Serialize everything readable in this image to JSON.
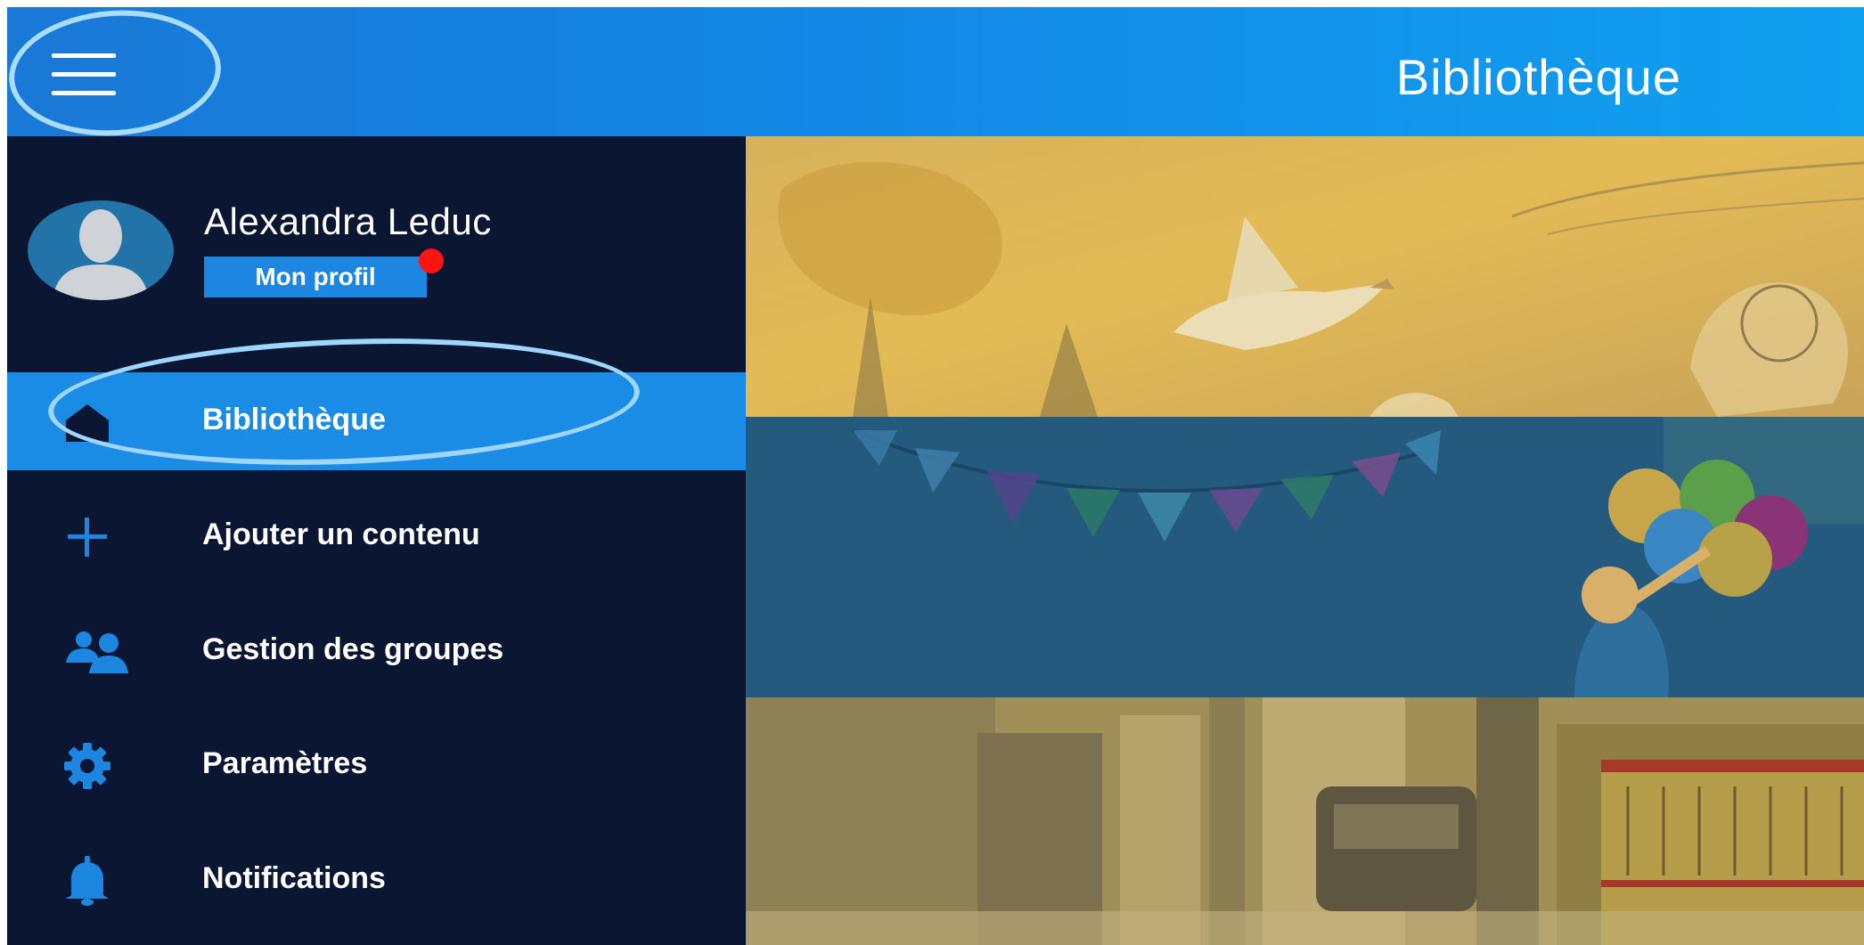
{
  "header": {
    "title": "Bibliothèque",
    "menu_icon": "hamburger-menu-icon"
  },
  "profile": {
    "name": "Alexandra Leduc",
    "button_label": "Mon profil",
    "avatar_icon": "user-silhouette-icon",
    "notification_dot_color": "#ff1313"
  },
  "nav": {
    "items": [
      {
        "label": "Bibliothèque",
        "icon": "home-icon",
        "active": true
      },
      {
        "label": "Ajouter un contenu",
        "icon": "plus-icon",
        "active": false
      },
      {
        "label": "Gestion des groupes",
        "icon": "group-icon",
        "active": false
      },
      {
        "label": "Paramètres",
        "icon": "gear-icon",
        "active": false
      },
      {
        "label": "Notifications",
        "icon": "bell-icon",
        "active": false
      }
    ]
  },
  "library": {
    "banners": [
      {
        "image": "sketch-bird-illustration"
      },
      {
        "image": "party-balloons-illustration"
      },
      {
        "image": "vintage-street-photo"
      }
    ]
  },
  "colors": {
    "header_blue": "#1388e6",
    "sidebar_navy": "#0b1632",
    "active_item": "#1a8ce6",
    "icon_blue": "#1d86e0",
    "annotation_circle": "#9fd6ff"
  }
}
